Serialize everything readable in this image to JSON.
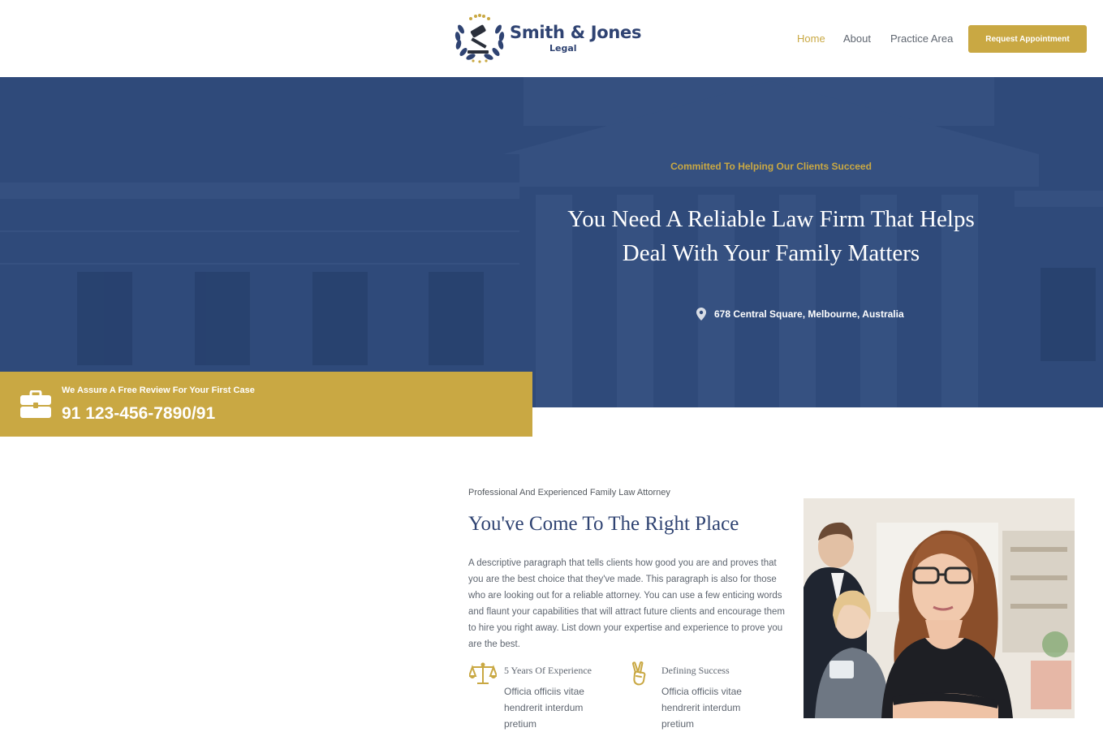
{
  "header": {
    "logo": {
      "name": "Smith & Jones",
      "sub": "Legal",
      "icon": "gavel-laurel-logo"
    },
    "nav": [
      {
        "label": "Home",
        "active": true
      },
      {
        "label": "About",
        "active": false
      },
      {
        "label": "Practice Area",
        "active": false
      }
    ],
    "cta_label": "Request Appointment"
  },
  "hero": {
    "tagline": "Committed To Helping Our Clients Succeed",
    "title_line1": "You Need A Reliable Law Firm That Helps",
    "title_line2": "Deal With Your Family Matters",
    "address": "678 Central Square, Melbourne, Australia",
    "address_icon": "map-pin-icon",
    "background": "courthouse-building-photo"
  },
  "promo": {
    "label": "We Assure A Free Review For Your First Case",
    "phone": "91 123-456-7890/91",
    "icon": "briefcase-icon"
  },
  "about": {
    "kicker": "Professional And Experienced Family Law Attorney",
    "title": "You've Come To The Right Place",
    "paragraph": "A descriptive paragraph that tells clients how good you are and proves that you are the best choice that they've made. This paragraph is also for those who are looking out for a reliable attorney. You can use a few enticing words and flaunt your capabilities that will attract future clients and encourage them to hire you right away. List down your expertise and experience to prove you are the best.",
    "features": [
      {
        "title": "5 Years Of Experience",
        "description": "Officia officiis vitae hendrerit interdum pretium",
        "icon": "scales-icon"
      },
      {
        "title": "Defining Success",
        "description": "Officia officiis vitae hendrerit interdum pretium",
        "icon": "victory-hand-icon"
      }
    ],
    "photo": "attorney-office-photo"
  },
  "colors": {
    "gold": "#c9a843",
    "navy": "#2f4372",
    "hero_overlay": "#2f4a7a",
    "text": "#5f6670"
  }
}
